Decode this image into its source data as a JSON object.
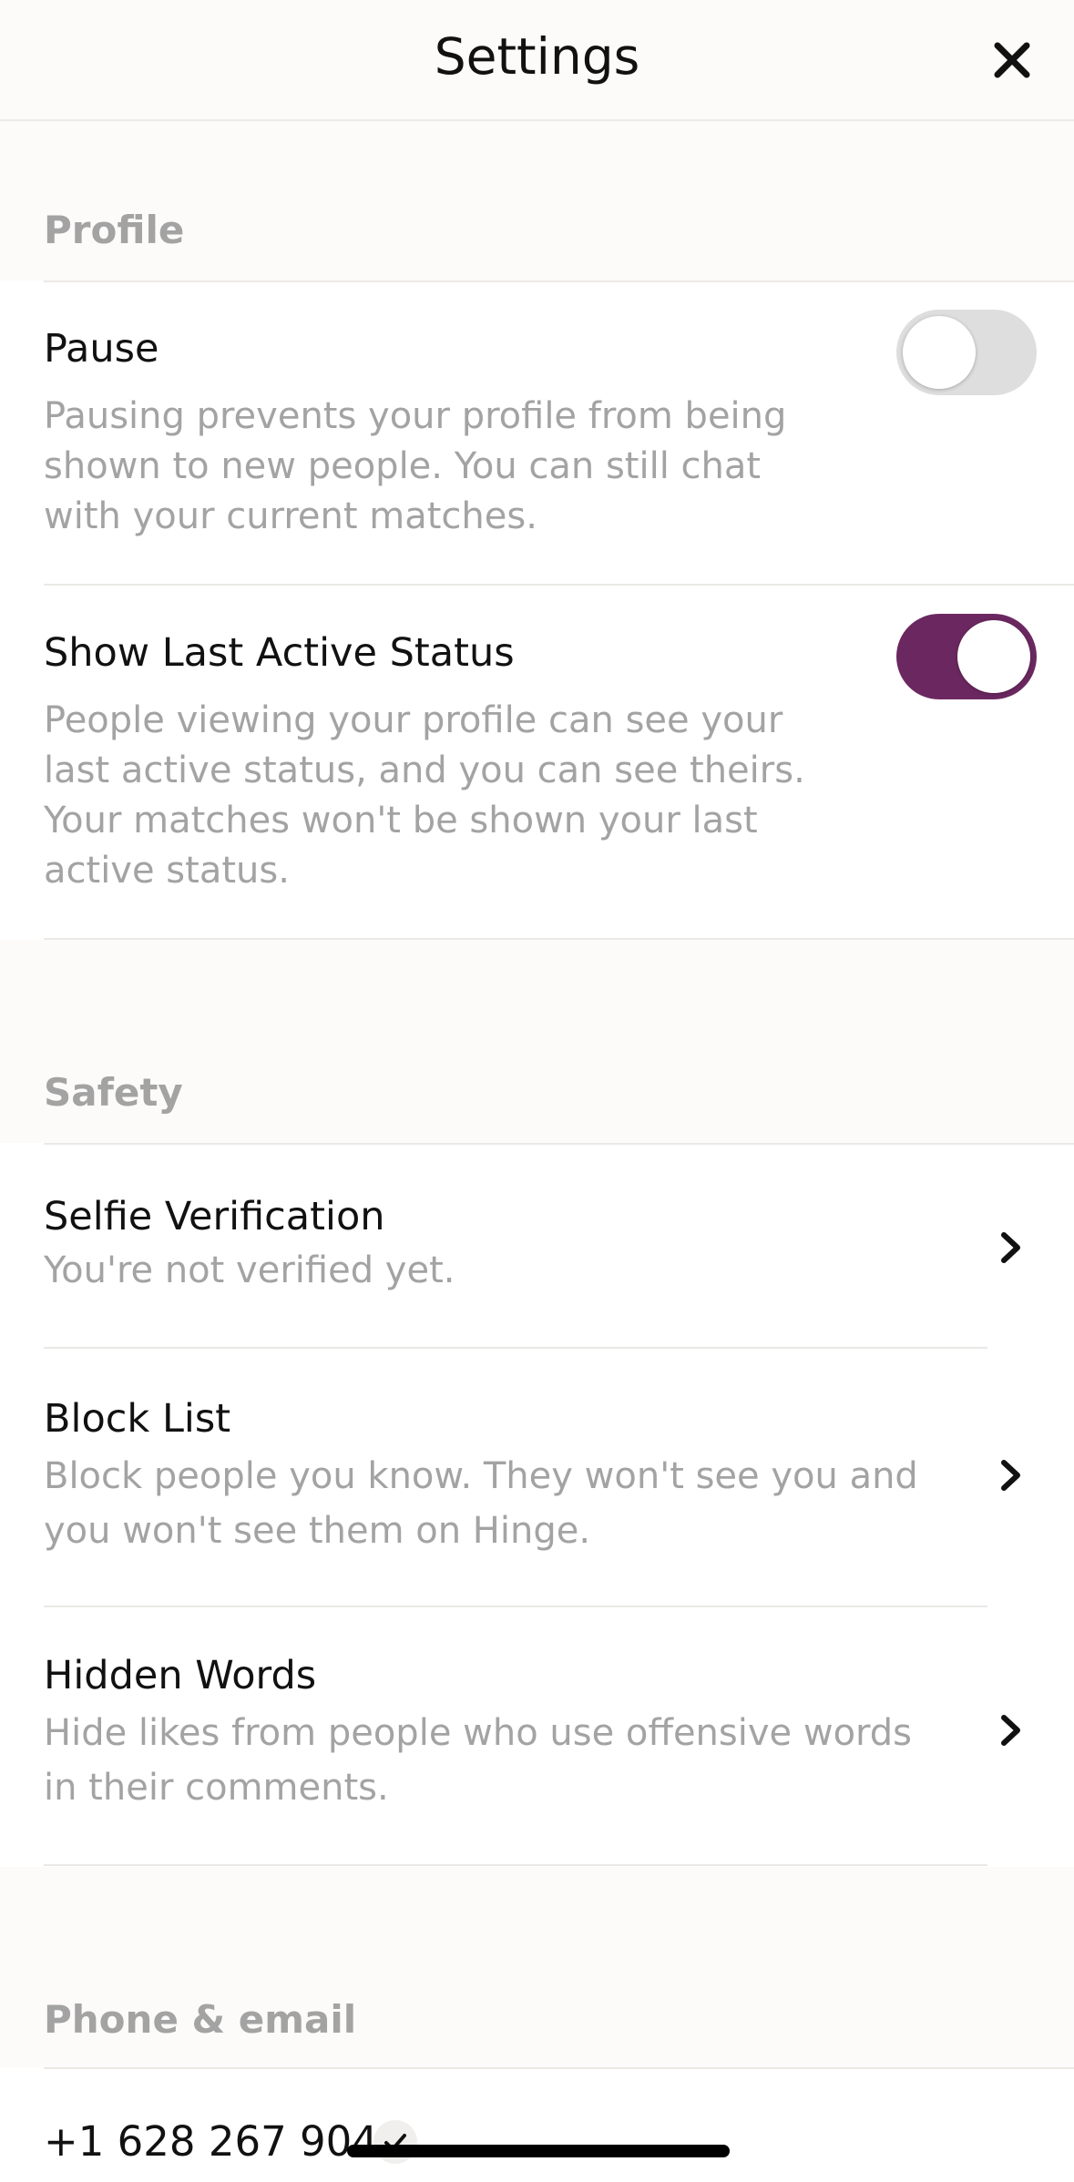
{
  "header": {
    "title": "Settings",
    "close_icon": "close-icon"
  },
  "colors": {
    "accent": "#6b2860",
    "muted_text": "#a3a3a3",
    "background": "#fcfbf9"
  },
  "profile": {
    "heading": "Profile",
    "pause": {
      "title": "Pause",
      "description": "Pausing prevents your profile from being shown to new people. You can still chat with your current matches.",
      "enabled": false
    },
    "last_active": {
      "title": "Show Last Active Status",
      "description": "People viewing your profile can see your last active status, and you can see theirs. Your matches won't be shown your last active status.",
      "enabled": true
    }
  },
  "safety": {
    "heading": "Safety",
    "items": [
      {
        "title": "Selfie Verification",
        "description": "You're not verified yet."
      },
      {
        "title": "Block List",
        "description": "Block people you know. They won't see you and you won't see them on Hinge."
      },
      {
        "title": "Hidden Words",
        "description": "Hide likes from people who use offensive words in their comments."
      }
    ]
  },
  "phone_email": {
    "heading": "Phone & email",
    "phone": "+1 628 267 9041"
  }
}
